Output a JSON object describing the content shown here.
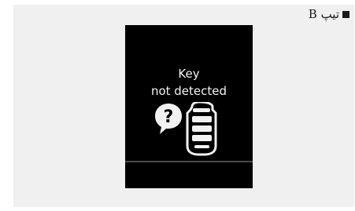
{
  "caption": {
    "text": "تیپ B"
  },
  "display": {
    "line1": "Key",
    "line2": "not detected",
    "icons": [
      "question-bubble-icon",
      "key-fob-icon"
    ]
  },
  "colors": {
    "panel_bg": "#f0f0f0",
    "display_bg": "#000000",
    "text_on_display": "#f2f2f2"
  }
}
